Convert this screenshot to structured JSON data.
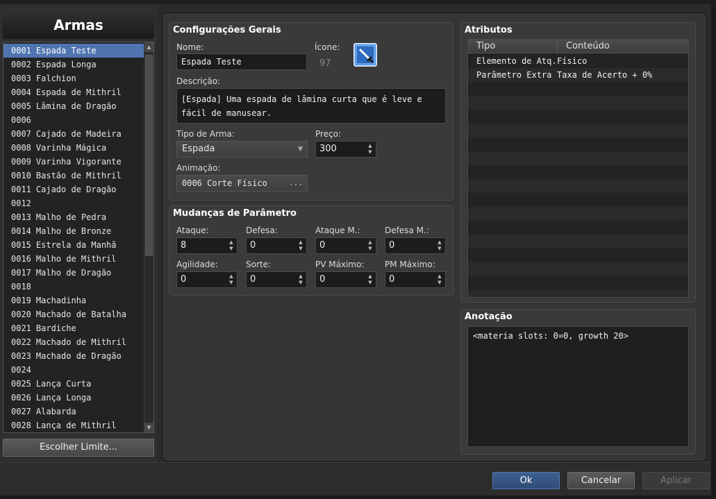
{
  "list": {
    "title": "Armas",
    "items": [
      {
        "id": "0001",
        "name": "Espada Teste"
      },
      {
        "id": "0002",
        "name": "Espada Longa"
      },
      {
        "id": "0003",
        "name": "Falchion"
      },
      {
        "id": "0004",
        "name": "Espada de Mithril"
      },
      {
        "id": "0005",
        "name": "Lâmina de Dragão"
      },
      {
        "id": "0006",
        "name": ""
      },
      {
        "id": "0007",
        "name": "Cajado de Madeira"
      },
      {
        "id": "0008",
        "name": "Varinha Mágica"
      },
      {
        "id": "0009",
        "name": "Varinha Vigorante"
      },
      {
        "id": "0010",
        "name": "Bastão de Mithril"
      },
      {
        "id": "0011",
        "name": "Cajado de Dragão"
      },
      {
        "id": "0012",
        "name": ""
      },
      {
        "id": "0013",
        "name": "Malho de Pedra"
      },
      {
        "id": "0014",
        "name": "Malho de Bronze"
      },
      {
        "id": "0015",
        "name": "Estrela da Manhã"
      },
      {
        "id": "0016",
        "name": "Malho de Mithril"
      },
      {
        "id": "0017",
        "name": "Malho de Dragão"
      },
      {
        "id": "0018",
        "name": ""
      },
      {
        "id": "0019",
        "name": "Machadinha"
      },
      {
        "id": "0020",
        "name": "Machado de Batalha"
      },
      {
        "id": "0021",
        "name": "Bardiche"
      },
      {
        "id": "0022",
        "name": "Machado de Mithril"
      },
      {
        "id": "0023",
        "name": "Machado de Dragão"
      },
      {
        "id": "0024",
        "name": ""
      },
      {
        "id": "0025",
        "name": "Lança Curta"
      },
      {
        "id": "0026",
        "name": "Lança Longa"
      },
      {
        "id": "0027",
        "name": "Alabarda"
      },
      {
        "id": "0028",
        "name": "Lança de Mithril"
      }
    ],
    "selected_index": 0,
    "limit_button": "Escolher Limite..."
  },
  "general": {
    "title": "Configurações Gerais",
    "name_label": "Nome:",
    "name_value": "Espada Teste",
    "icon_label": "Ícone:",
    "icon_index": "97",
    "icon": "sword-icon",
    "desc_label": "Descrição:",
    "desc_line1": "[Espada] Uma espada de lâmina curta que é leve e",
    "desc_line2": "fácil de manusear.",
    "type_label": "Tipo de Arma:",
    "type_value": "Espada",
    "price_label": "Preço:",
    "price_value": "300",
    "anim_label": "Animação:",
    "anim_value": "0006 Corte Físico",
    "anim_button": "..."
  },
  "params": {
    "title": "Mudanças de Parâmetro",
    "fields": [
      {
        "label": "Ataque:",
        "value": "8"
      },
      {
        "label": "Defesa:",
        "value": "0"
      },
      {
        "label": "Ataque M.:",
        "value": "0"
      },
      {
        "label": "Defesa M.:",
        "value": "0"
      },
      {
        "label": "Agilidade:",
        "value": "0"
      },
      {
        "label": "Sorte:",
        "value": "0"
      },
      {
        "label": "PV Máximo:",
        "value": "0"
      },
      {
        "label": "PM Máximo:",
        "value": "0"
      }
    ]
  },
  "attributes": {
    "title": "Atributos",
    "columns": [
      "Tipo",
      "Conteúdo"
    ],
    "rows": [
      {
        "type": "Elemento de Atq.",
        "content": "Físico"
      },
      {
        "type": "Parâmetro Extra",
        "content": "Taxa de Acerto + 0%"
      }
    ]
  },
  "note": {
    "title": "Anotação",
    "text": "<materia slots: 0=0, growth 20>"
  },
  "buttons": {
    "ok": "Ok",
    "cancel": "Cancelar",
    "apply": "Aplicar"
  },
  "colors": {
    "selection": "#4f74b0",
    "ok_button": "#2f4c75",
    "icon_blue": "#3f8de0"
  }
}
